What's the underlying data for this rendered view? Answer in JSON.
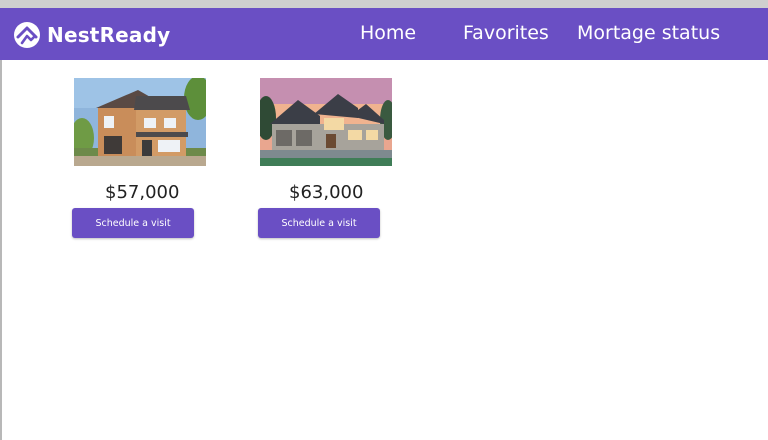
{
  "app": {
    "brand": "NestReady",
    "logo_icon": "house-arrow-logo-icon"
  },
  "colors": {
    "accent": "#6a4fc4",
    "nav_text": "#ffffff",
    "price_text": "#222222"
  },
  "nav": {
    "home": "Home",
    "favorites": "Favorites",
    "mortgage": "Mortage status"
  },
  "listings": [
    {
      "price": "$57,000",
      "button": "Schedule a visit",
      "image_icon": "brick-house-photo"
    },
    {
      "price": "$63,000",
      "button": "Schedule a visit",
      "image_icon": "gray-house-photo"
    }
  ]
}
